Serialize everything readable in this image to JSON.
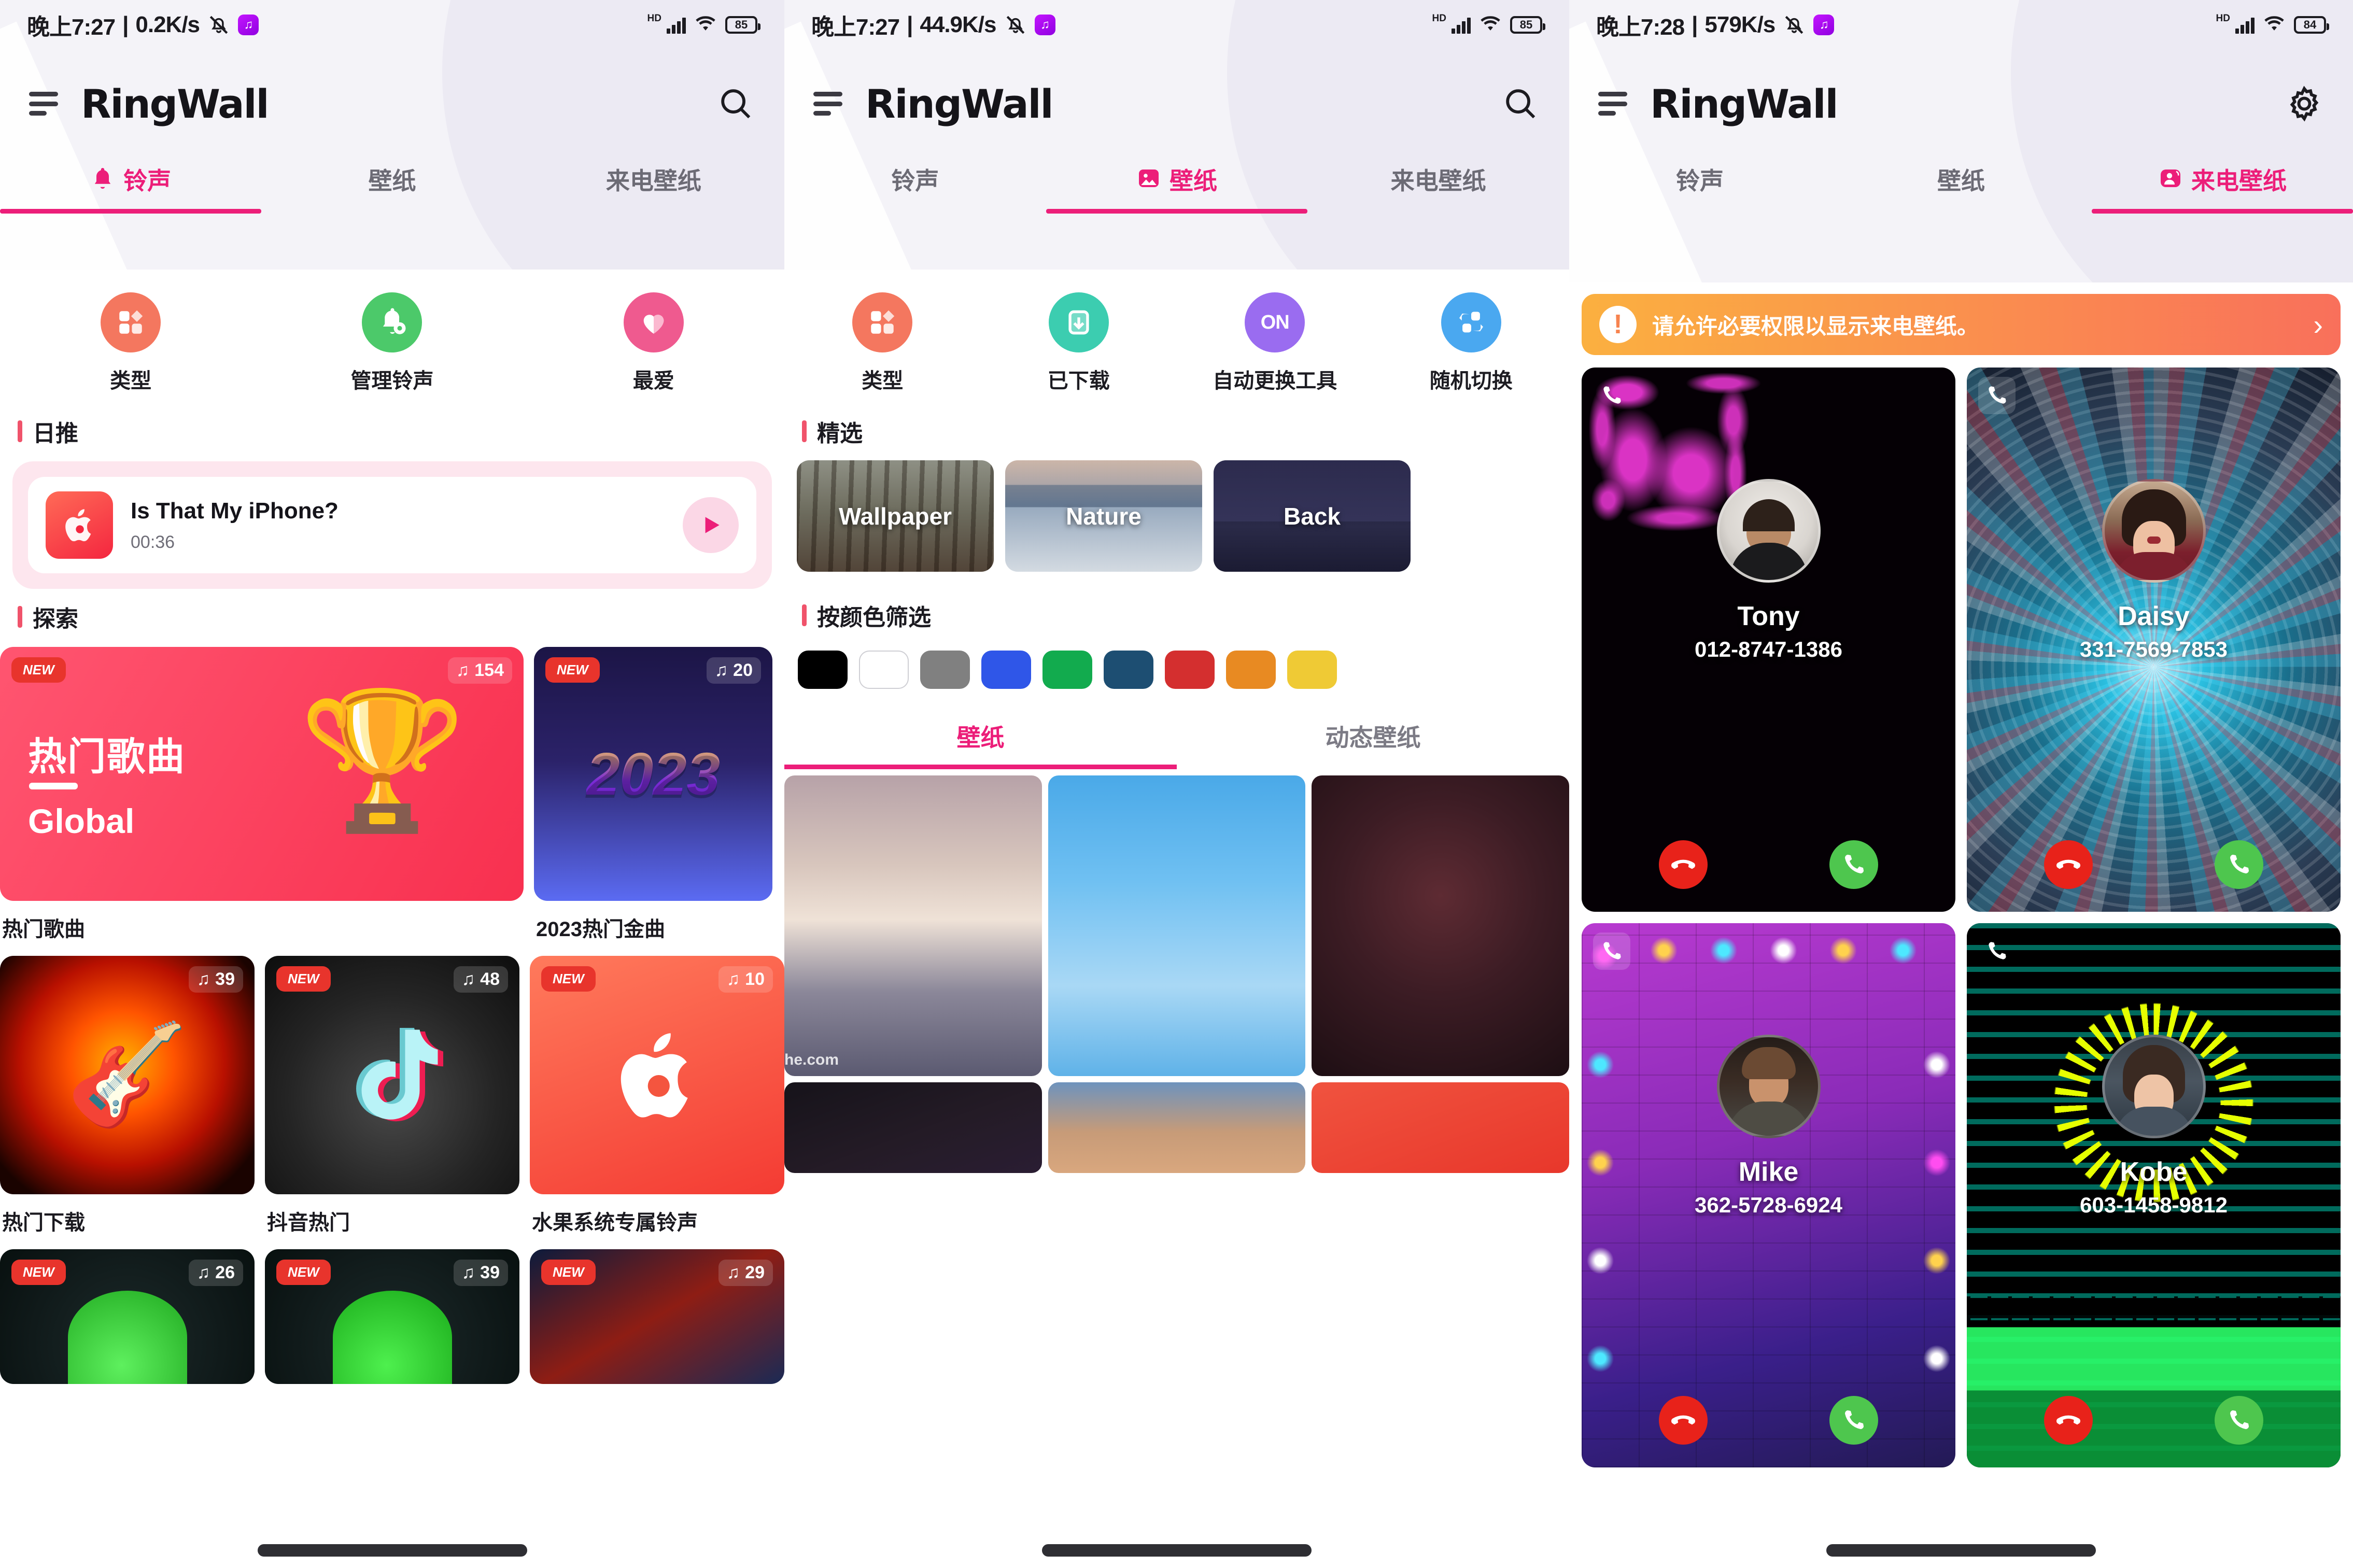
{
  "app": {
    "brand": "RingWall"
  },
  "panels": [
    {
      "id": "ringtones",
      "status": {
        "time": "晚上7:27",
        "sep": "|",
        "net_speed": "0.2K/s",
        "hd": "HD",
        "battery": "85"
      },
      "appbar": {
        "menu_icon": "hamburger-menu-icon",
        "title": "RingWall",
        "action_icon": "search-icon"
      },
      "tabs": [
        {
          "label": "铃声",
          "icon": "bell-icon",
          "active": true
        },
        {
          "label": "壁纸",
          "icon": "image-icon",
          "active": false
        },
        {
          "label": "来电壁纸",
          "icon": "caller-image-icon",
          "active": false
        }
      ],
      "quick_actions": [
        {
          "label": "类型",
          "icon": "grid-category-icon",
          "color": "#f4775f"
        },
        {
          "label": "管理铃声",
          "icon": "bell-gear-icon",
          "color": "#4cc96a"
        },
        {
          "label": "最爱",
          "icon": "heart-icon",
          "color": "#ef5a8f"
        }
      ],
      "section_daily": "日推",
      "daily": {
        "title": "Is That My iPhone?",
        "duration": "00:36",
        "art_icon": "apple-music-icon",
        "play_icon": "play-icon"
      },
      "section_explore": "探索",
      "explore_row1": [
        {
          "title": "热门歌曲",
          "subtitle": "Global",
          "label": "热门歌曲",
          "count": "154",
          "new": "NEW",
          "art": "trophy"
        },
        {
          "title": "2023",
          "label": "2023热门金曲",
          "count": "20",
          "new": "NEW",
          "art": "2023"
        }
      ],
      "explore_row2": [
        {
          "label": "热门下载",
          "count": "39",
          "new": "",
          "art": "fire-guitar"
        },
        {
          "label": "抖音热门",
          "count": "48",
          "new": "NEW",
          "art": "tiktok"
        },
        {
          "label": "水果系统专属铃声",
          "count": "10",
          "new": "NEW",
          "art": "apple"
        }
      ],
      "explore_row3": [
        {
          "label": "",
          "count": "26",
          "new": "NEW",
          "art": "green-phone"
        },
        {
          "label": "",
          "count": "39",
          "new": "NEW",
          "art": "green-phone"
        },
        {
          "label": "",
          "count": "29",
          "new": "NEW",
          "art": "concert"
        }
      ]
    },
    {
      "id": "wallpaper",
      "status": {
        "time": "晚上7:27",
        "sep": "|",
        "net_speed": "44.9K/s",
        "hd": "HD",
        "battery": "85"
      },
      "appbar": {
        "menu_icon": "hamburger-menu-icon",
        "title": "RingWall",
        "action_icon": "search-icon"
      },
      "tabs": [
        {
          "label": "铃声",
          "icon": "bell-icon",
          "active": false
        },
        {
          "label": "壁纸",
          "icon": "image-icon",
          "active": true
        },
        {
          "label": "来电壁纸",
          "icon": "caller-image-icon",
          "active": false
        }
      ],
      "quick_actions": [
        {
          "label": "类型",
          "icon": "grid-category-icon",
          "color": "#f4775f"
        },
        {
          "label": "已下载",
          "icon": "download-box-icon",
          "color": "#3ccdb0"
        },
        {
          "label": "自动更换工具",
          "icon": "on-toggle-icon",
          "color": "#9a6cf0"
        },
        {
          "label": "随机切换",
          "icon": "shuffle-icon",
          "color": "#4aa8f0"
        }
      ],
      "section_featured": "精选",
      "featured": [
        {
          "label": "Wallpaper"
        },
        {
          "label": "Nature"
        },
        {
          "label": "Back"
        }
      ],
      "section_colors": "按颜色筛选",
      "colors": [
        "#000000",
        "#ffffff",
        "#808080",
        "#2f56e8",
        "#12ab4e",
        "#1d4e72",
        "#d42f2f",
        "#e88a22",
        "#efca35"
      ],
      "subtabs": [
        {
          "label": "壁纸",
          "active": true
        },
        {
          "label": "动态壁纸",
          "active": false
        }
      ],
      "watermark": "he.com"
    },
    {
      "id": "caller-wallpaper",
      "status": {
        "time": "晚上7:28",
        "sep": "|",
        "net_speed": "579K/s",
        "hd": "HD",
        "battery": "84"
      },
      "appbar": {
        "menu_icon": "hamburger-menu-icon",
        "title": "RingWall",
        "action_icon": "gear-icon"
      },
      "tabs": [
        {
          "label": "铃声",
          "icon": "bell-icon",
          "active": false
        },
        {
          "label": "壁纸",
          "icon": "image-icon",
          "active": false
        },
        {
          "label": "来电壁纸",
          "icon": "caller-image-icon",
          "active": true
        }
      ],
      "permission": {
        "text": "请允许必要权限以显示来电壁纸。",
        "icon": "alert-exclamation-icon",
        "arrow": "›"
      },
      "callers": [
        {
          "name": "Tony",
          "number": "012-8747-1386",
          "theme": "neon-hearts",
          "decline_icon": "decline-call-icon",
          "accept_icon": "accept-call-icon",
          "phone_icon": "phone-icon"
        },
        {
          "name": "Daisy",
          "number": "331-7569-7853",
          "theme": "light-tunnel",
          "decline_icon": "decline-call-icon",
          "accept_icon": "accept-call-icon",
          "phone_icon": "phone-icon"
        },
        {
          "name": "Mike",
          "number": "362-5728-6924",
          "theme": "bulb-frame",
          "decline_icon": "decline-call-icon",
          "accept_icon": "accept-call-icon",
          "phone_icon": "phone-icon"
        },
        {
          "name": "Kobe",
          "number": "603-1458-9812",
          "theme": "matrix-equalizer",
          "decline_icon": "decline-call-icon",
          "accept_icon": "accept-call-icon",
          "phone_icon": "phone-icon"
        }
      ]
    }
  ],
  "accent": "#ec1e79",
  "section_marker_color": "#f0536b"
}
